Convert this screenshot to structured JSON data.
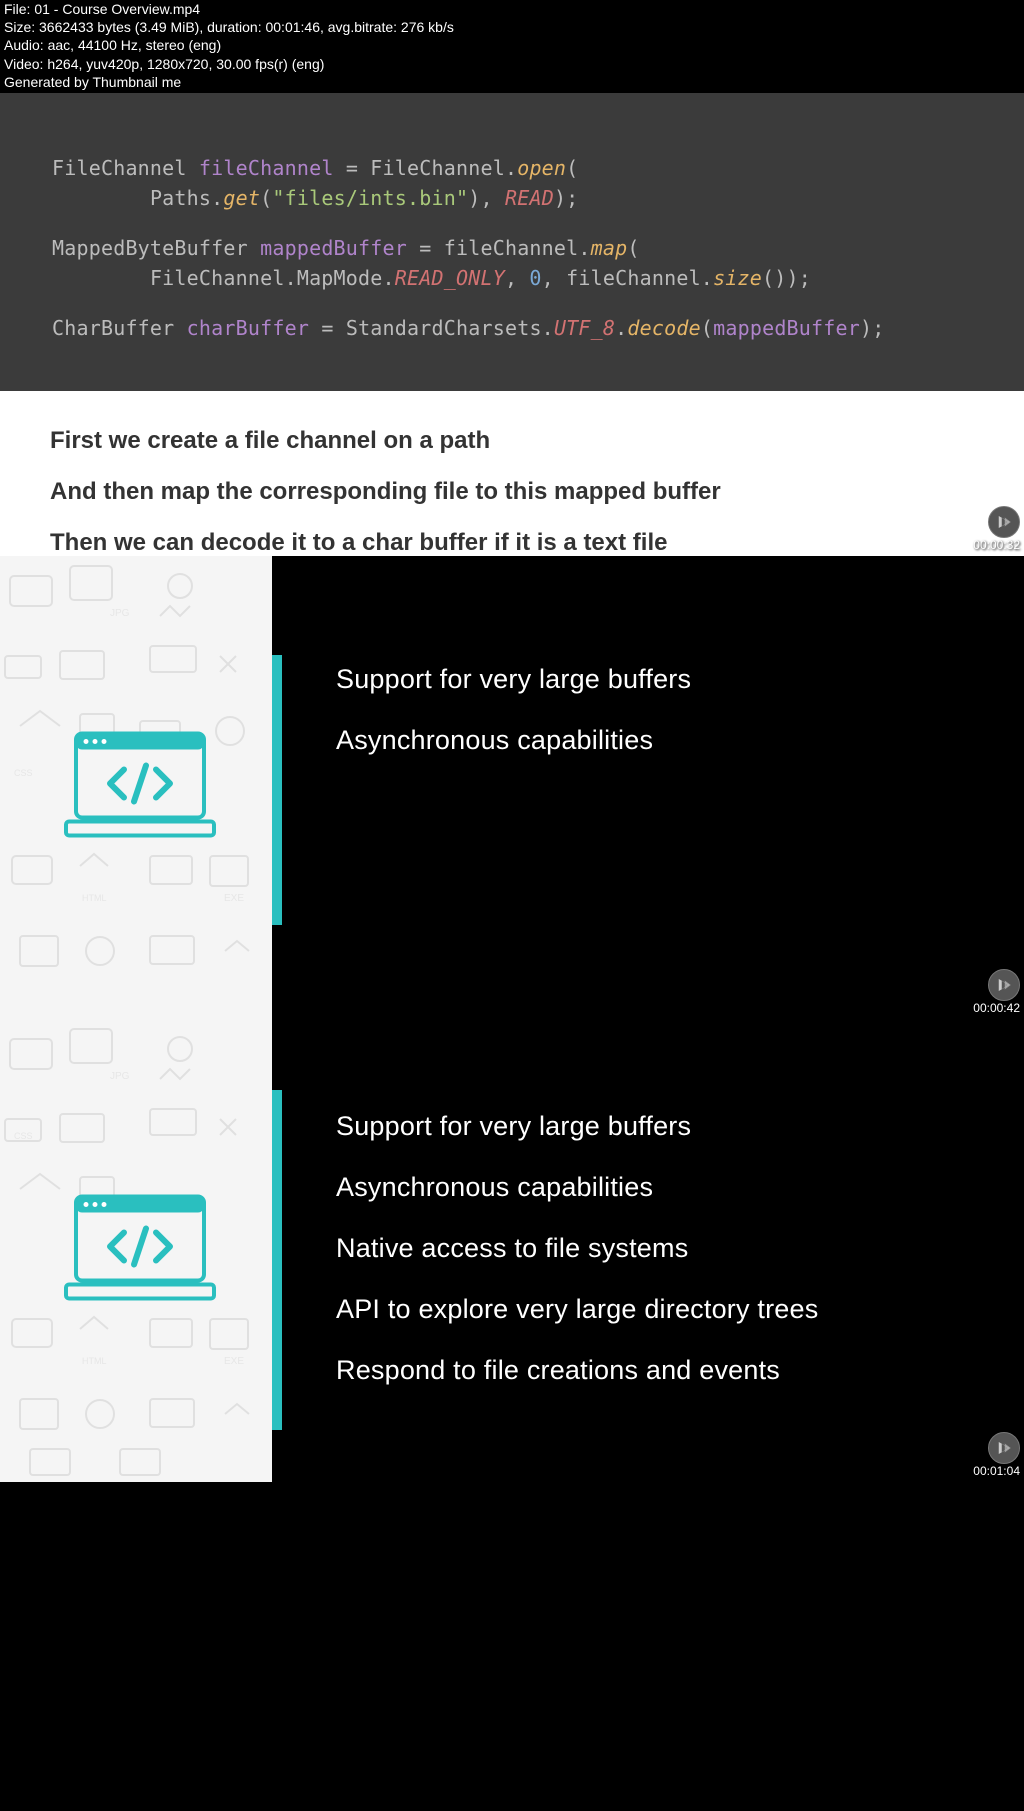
{
  "header": {
    "line1": "File: 01 - Course Overview.mp4",
    "line2": "Size: 3662433 bytes (3.49 MiB), duration: 00:01:46, avg.bitrate: 276 kb/s",
    "line3": "Audio: aac, 44100 Hz, stereo (eng)",
    "line4": "Video: h264, yuv420p, 1280x720, 30.00 fps(r) (eng)",
    "line5": "Generated by Thumbnail me"
  },
  "code": {
    "l1": {
      "type": "FileChannel",
      "var": "fileChannel",
      "eq": " = ",
      "cls": "FileChannel.",
      "call": "open",
      "open": "("
    },
    "l2": {
      "indent": "        ",
      "cls": "Paths.",
      "call": "get",
      "open": "(",
      "str": "\"files/ints.bin\"",
      "comma": "), ",
      "const": "READ",
      "close": ");"
    },
    "l3": {
      "type": "MappedByteBuffer",
      "sp": " ",
      "var": "mappedBuffer",
      "eq": " = ",
      "obj": "fileChannel.",
      "call": "map",
      "open": "("
    },
    "l4": {
      "indent": "        ",
      "cls": "FileChannel.MapMode.",
      "const": "READ_ONLY",
      "c1": ", ",
      "num": "0",
      "c2": ", ",
      "obj": "fileChannel.",
      "call": "size",
      "close": "());"
    },
    "l5": {
      "type": "CharBuffer",
      "sp": " ",
      "var": "charBuffer",
      "eq": " = ",
      "cls": "StandardCharsets.",
      "const": "UTF_8",
      "dot": ".",
      "call": "decode",
      "open": "(",
      "arg": "mappedBuffer",
      "close": ");"
    }
  },
  "explain": {
    "p1": "First we create a file channel on a path",
    "p2": "And then map the corresponding file to this mapped buffer",
    "p3": "Then we can decode it to a char buffer if it is a text file"
  },
  "slides": {
    "s2": {
      "bullets": [
        "Support for very large buffers",
        "Asynchronous capabilities"
      ]
    },
    "s3": {
      "bullets": [
        "Support for very large buffers",
        "Asynchronous capabilities",
        "Native access to file systems",
        "API to explore very large directory trees",
        "Respond to file creations and events"
      ]
    }
  },
  "timestamps": {
    "t1": "00:00:32",
    "t2": "00:00:42",
    "t3": "00:01:04"
  }
}
